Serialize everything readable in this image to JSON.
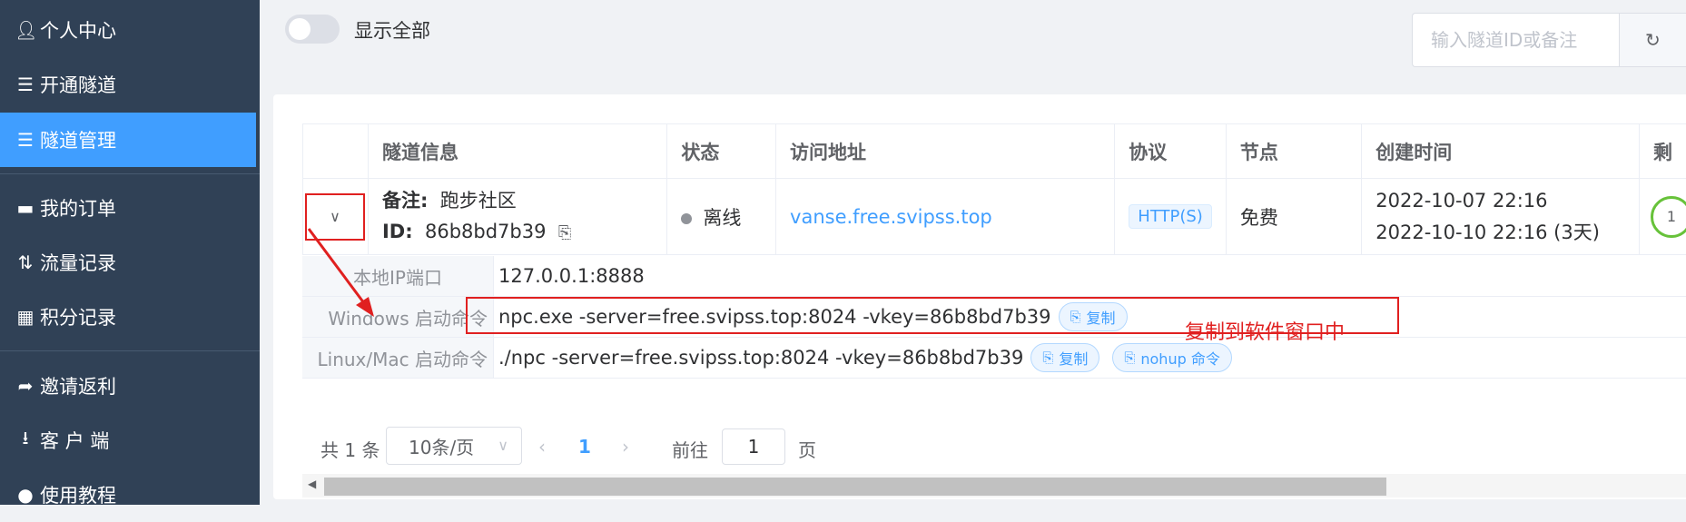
{
  "sidebar": {
    "items": [
      {
        "label": "个人中心",
        "icon": "user-icon"
      },
      {
        "label": "开通隧道",
        "icon": "server-icon"
      },
      {
        "label": "隧道管理",
        "icon": "list-icon",
        "active": true
      },
      {
        "label": "我的订单",
        "icon": "card-icon"
      },
      {
        "label": "流量记录",
        "icon": "sort-arrows-icon"
      },
      {
        "label": "积分记录",
        "icon": "gift-icon"
      },
      {
        "label": "邀请返利",
        "icon": "share-icon"
      },
      {
        "label": "客 户 端",
        "icon": "download-icon"
      },
      {
        "label": "使用教程",
        "icon": "help-icon"
      }
    ]
  },
  "toolbar": {
    "toggle_label": "显示全部",
    "search_placeholder": "输入隧道ID或备注"
  },
  "table": {
    "headers": [
      "隧道信息",
      "状态",
      "访问地址",
      "协议",
      "节点",
      "创建时间",
      "剩"
    ],
    "row": {
      "note_key": "备注:",
      "note_value": "跑步社区",
      "id_key": "ID:",
      "id_value": "86b8bd7b39",
      "status": "离线",
      "address": "vanse.free.svipss.top",
      "protocol": "HTTP(S)",
      "node": "免费",
      "created": "2022-10-07 22:16",
      "expires": "2022-10-10 22:16 (3天)",
      "extra": "1"
    }
  },
  "details": {
    "local_label": "本地IP端口",
    "local_value": "127.0.0.1:8888",
    "windows_label": "Windows 启动命令",
    "windows_value": "npc.exe -server=free.svipss.top:8024 -vkey=86b8bd7b39",
    "linux_label": "Linux/Mac 启动命令",
    "linux_value": "./npc -server=free.svipss.top:8024 -vkey=86b8bd7b39",
    "copy_label": "复制",
    "nohup_label": "nohup 命令"
  },
  "annotation": "复制到软件窗口中",
  "pagination": {
    "total": "共 1 条",
    "page_size": "10条/页",
    "current": "1",
    "goto_label": "前往",
    "goto_value": "1",
    "page_unit": "页"
  },
  "colors": {
    "sidebar_bg": "#304156",
    "active": "#409eff",
    "annotation_red": "#e02020"
  }
}
